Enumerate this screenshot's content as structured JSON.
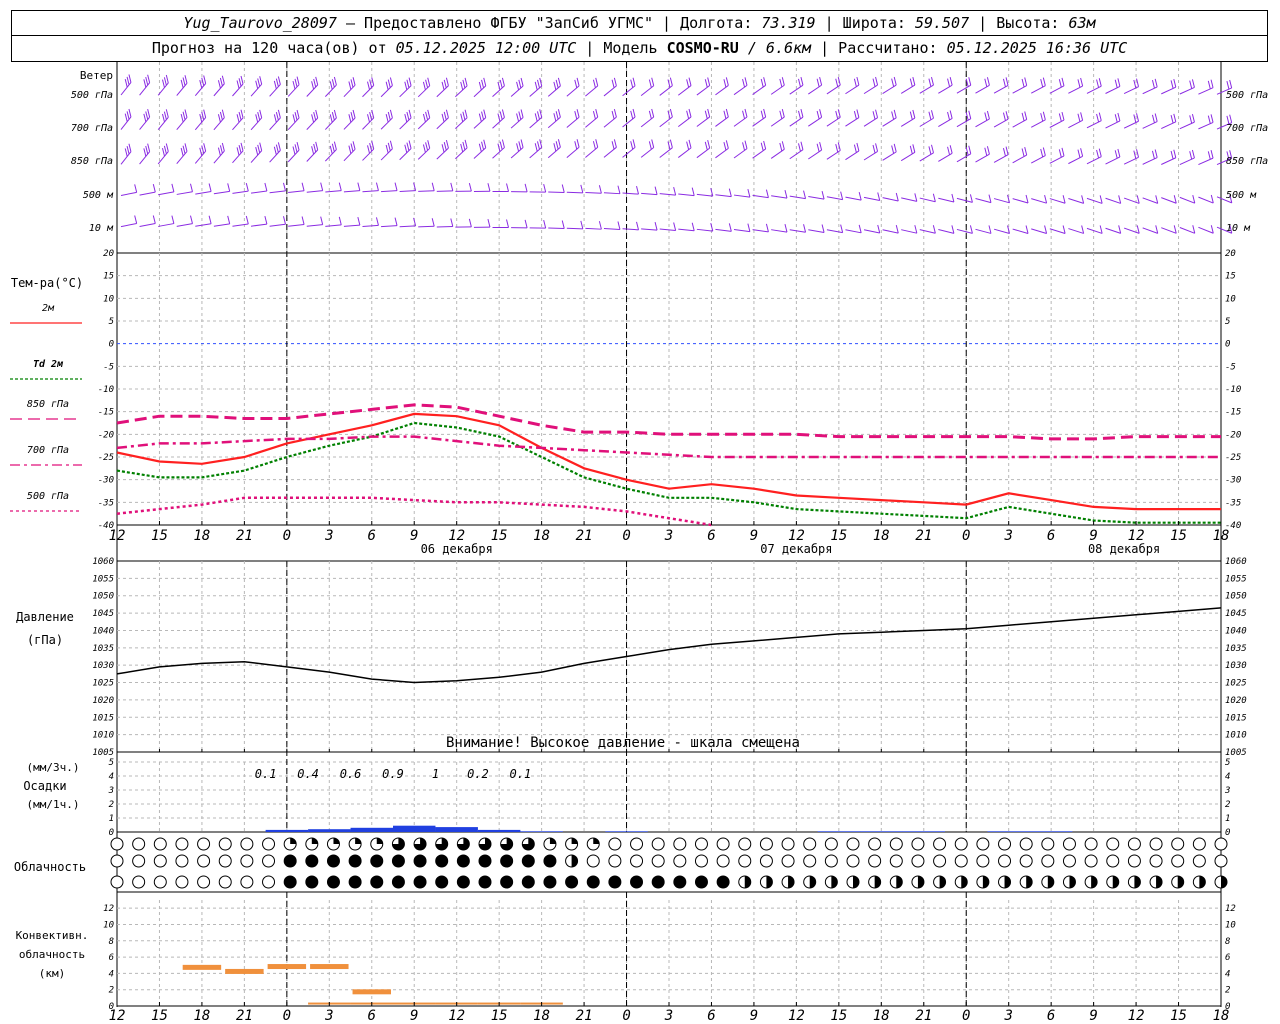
{
  "header": {
    "station": "Yug_Taurovo_28097",
    "provider": " – Предоставлено ФГБУ \"ЗапСиб УГМС\" | Долгота: ",
    "lon": "73.319",
    "lat_label": " | Широта: ",
    "lat": "59.507",
    "alt_label": " | Высота: ",
    "alt": "63м",
    "forecast_label": "Прогноз на 120 часа(ов) от ",
    "forecast_start": "05.12.2025 12:00 UTC",
    "model_label": "  | Модель ",
    "model": "COSMO-RU",
    "resolution": " / 6.6км",
    "calc_label": " | Рассчитано: ",
    "calc_time": "05.12.2025 16:36 UTC"
  },
  "wind_panel": {
    "title": "Ветер",
    "levels": [
      "500 гПа",
      "700 гПа",
      "850 гПа",
      "500 м",
      "10  м"
    ],
    "barb_color": "#8a2be2"
  },
  "temp_panel": {
    "title": "Тем-ра(°C)",
    "legend": [
      {
        "label": "2м",
        "color": "#ff2020",
        "dash": ""
      },
      {
        "label": "Td 2м",
        "color": "#008000",
        "dash": "3,2"
      },
      {
        "label": "850 гПа",
        "color": "#e0107a",
        "dash": "12,6"
      },
      {
        "label": "700 гПа",
        "color": "#e0107a",
        "dash": "10,4,3,4"
      },
      {
        "label": "500 гПа",
        "color": "#e0107a",
        "dash": "3,3"
      }
    ],
    "y_ticks": [
      "20",
      "15",
      "10",
      "5",
      "0",
      "-5",
      "-10",
      "-15",
      "-20",
      "-25",
      "-30",
      "-35",
      "-40"
    ]
  },
  "time_axis": {
    "hour_labels": [
      "12",
      "15",
      "18",
      "21",
      "0",
      "3",
      "6",
      "9",
      "12",
      "15",
      "18",
      "21",
      "0",
      "3",
      "6",
      "9",
      "12",
      "15",
      "18",
      "21",
      "0",
      "3",
      "6",
      "9",
      "12",
      "15",
      "18"
    ],
    "dates": [
      "06 декабря",
      "07 декабря",
      "08 декабря"
    ]
  },
  "pressure_panel": {
    "title_line1": "Давление",
    "title_line2": "(гПа)",
    "warning": "Внимание! Высокое давление - шкала смещена",
    "y_ticks": [
      "1060",
      "1055",
      "1050",
      "1045",
      "1040",
      "1035",
      "1030",
      "1025",
      "1020",
      "1015",
      "1010",
      "1005"
    ]
  },
  "precip_panel": {
    "label_3h": "(мм/3ч.)",
    "label_main": "Осадки",
    "label_1h": "(мм/1ч.)",
    "y_ticks": [
      "5",
      "4",
      "3",
      "2",
      "1",
      "0"
    ],
    "amounts_3h": [
      "0.1",
      "0.4",
      "0.6",
      "0.9",
      "1",
      "0.2",
      "0.1"
    ],
    "bar_color": "#2040e0"
  },
  "cloud_panel": {
    "title": "Облачность"
  },
  "conv_panel": {
    "title_line1": "Конвективн.",
    "title_line2": "облачность",
    "title_line3": "(км)",
    "y_ticks": [
      "12",
      "10",
      "8",
      "6",
      "4",
      "2",
      "0"
    ],
    "bar_color": "#f0903c"
  },
  "chart_data": [
    {
      "type": "line",
      "title": "Тем-ра(°C)",
      "x": [
        "12",
        "15",
        "18",
        "21",
        "0",
        "3",
        "6",
        "9",
        "12",
        "15",
        "18",
        "21",
        "0",
        "3",
        "6",
        "9",
        "12",
        "15",
        "18",
        "21",
        "0",
        "3",
        "6",
        "9",
        "12",
        "15",
        "18"
      ],
      "ylim": [
        -40,
        20
      ],
      "series": [
        {
          "name": "2м",
          "values": [
            -24,
            -26,
            -26.5,
            -25,
            -22,
            -20,
            -18,
            -15.5,
            -16,
            -18,
            -23,
            -27.5,
            -30,
            -32,
            -31,
            -32,
            -33.5,
            -34,
            -34.5,
            -35,
            -35.5,
            -33,
            -34.5,
            -36,
            -36.5,
            -36.5,
            -36.5
          ]
        },
        {
          "name": "Td 2м",
          "values": [
            -28,
            -29.5,
            -29.5,
            -28,
            -25,
            -22.5,
            -20.5,
            -17.5,
            -18.5,
            -20.5,
            -25,
            -29.5,
            -32,
            -34,
            -34,
            -35,
            -36.5,
            -37,
            -37.5,
            -38,
            -38.5,
            -36,
            -37.5,
            -39,
            -39.5,
            -39.5,
            -39.5
          ]
        },
        {
          "name": "850 гПа",
          "values": [
            -17.5,
            -16,
            -16,
            -16.5,
            -16.5,
            -15.5,
            -14.5,
            -13.5,
            -14,
            -16,
            -18,
            -19.5,
            -19.5,
            -20,
            -20,
            -20,
            -20,
            -20.5,
            -20.5,
            -20.5,
            -20.5,
            -20.5,
            -21,
            -21,
            -20.5,
            -20.5,
            -20.5
          ]
        },
        {
          "name": "700 гПа",
          "values": [
            -23,
            -22,
            -22,
            -21.5,
            -21,
            -21,
            -20.5,
            -20.5,
            -21.5,
            -22.5,
            -23,
            -23.5,
            -24,
            -24.5,
            -25,
            -25,
            -25,
            -25,
            -25,
            -25,
            -25,
            -25,
            -25,
            -25,
            -25,
            -25,
            -25
          ]
        },
        {
          "name": "500 гПа",
          "values": [
            -37.5,
            -36.5,
            -35.5,
            -34,
            -34,
            -34,
            -34,
            -34.5,
            -35,
            -35,
            -35.5,
            -36,
            -37,
            -38.5,
            -40,
            null,
            null,
            null,
            null,
            null,
            null,
            null,
            null,
            null,
            null,
            null,
            null
          ]
        }
      ]
    },
    {
      "type": "line",
      "title": "Давление",
      "x": [
        "12",
        "15",
        "18",
        "21",
        "0",
        "3",
        "6",
        "9",
        "12",
        "15",
        "18",
        "21",
        "0",
        "3",
        "6",
        "9",
        "12",
        "15",
        "18",
        "21",
        "0",
        "3",
        "6",
        "9",
        "12",
        "15",
        "18"
      ],
      "ylim": [
        1005,
        1060
      ],
      "series": [
        {
          "name": "Давление",
          "values": [
            1027.5,
            1029.5,
            1030.5,
            1031,
            1029.5,
            1028,
            1026,
            1025,
            1025.5,
            1026.5,
            1028,
            1030.5,
            1032.5,
            1034.5,
            1036,
            1037,
            1038,
            1039,
            1039.5,
            1040,
            1040.5,
            1041.5,
            1042.5,
            1043.5,
            1044.5,
            1045.5,
            1046.5
          ]
        }
      ]
    },
    {
      "type": "bar",
      "title": "Осадки",
      "x": [
        "12",
        "15",
        "18",
        "21",
        "0",
        "3",
        "6",
        "9",
        "12",
        "15",
        "18",
        "21",
        "0",
        "3",
        "6",
        "9",
        "12",
        "15",
        "18",
        "21",
        "0",
        "3",
        "6",
        "9",
        "12",
        "15",
        "18"
      ],
      "ylim": [
        0,
        5
      ],
      "series": [
        {
          "name": "мм/1ч",
          "values": [
            0,
            0,
            0,
            0,
            0.15,
            0.2,
            0.3,
            0.45,
            0.35,
            0.15,
            0.05,
            0,
            0.05,
            0,
            0,
            0,
            0,
            0.05,
            0.05,
            0.05,
            0,
            0.05,
            0.05,
            0,
            0,
            0,
            0
          ]
        }
      ]
    },
    {
      "type": "bar",
      "title": "Конвективн. облачность",
      "x": [
        "12",
        "15",
        "18",
        "21",
        "0",
        "3",
        "6",
        "9",
        "12",
        "15",
        "18",
        "21",
        "0",
        "3",
        "6",
        "9",
        "12",
        "15",
        "18",
        "21",
        "0",
        "3",
        "6",
        "9",
        "12",
        "15",
        "18"
      ],
      "ylim": [
        0,
        13
      ],
      "series": [
        {
          "name": "верхняя граница",
          "values": [
            null,
            null,
            4.8,
            4.3,
            4.9,
            4.9,
            1.8,
            null,
            null,
            null,
            null,
            null,
            null,
            null,
            null,
            null,
            null,
            null,
            null,
            null,
            null,
            null,
            null,
            null,
            null,
            null,
            null
          ]
        },
        {
          "name": "нижняя граница",
          "values": [
            null,
            null,
            null,
            null,
            null,
            0.3,
            0.3,
            0.3,
            0.3,
            0.3,
            0.3,
            null,
            null,
            null,
            null,
            null,
            null,
            null,
            null,
            null,
            null,
            null,
            null,
            null,
            null,
            null,
            null
          ]
        }
      ]
    }
  ]
}
